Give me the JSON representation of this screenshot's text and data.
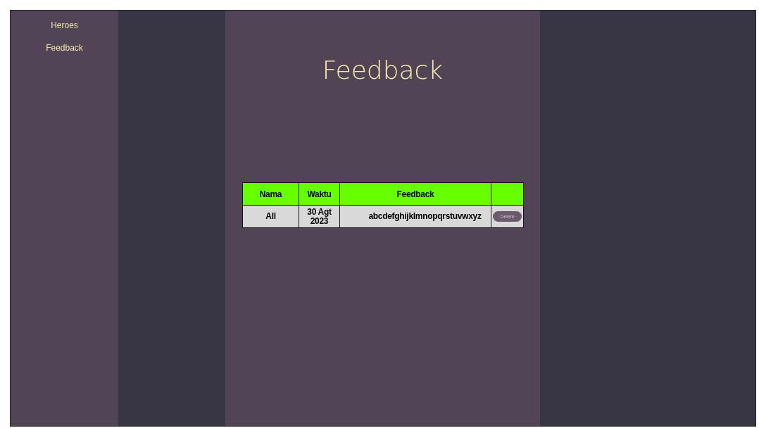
{
  "sidebar": {
    "items": [
      {
        "label": "Heroes"
      },
      {
        "label": "Feedback"
      }
    ]
  },
  "page_title": "Feedback",
  "table": {
    "columns": [
      "Nama",
      "Waktu",
      "Feedback",
      ""
    ],
    "rows": [
      {
        "nama": "All",
        "waktu": "30 Agt 2023",
        "feedback": "abcdefghijklmnopqrstuvwxyz",
        "action": "Delete"
      }
    ]
  }
}
